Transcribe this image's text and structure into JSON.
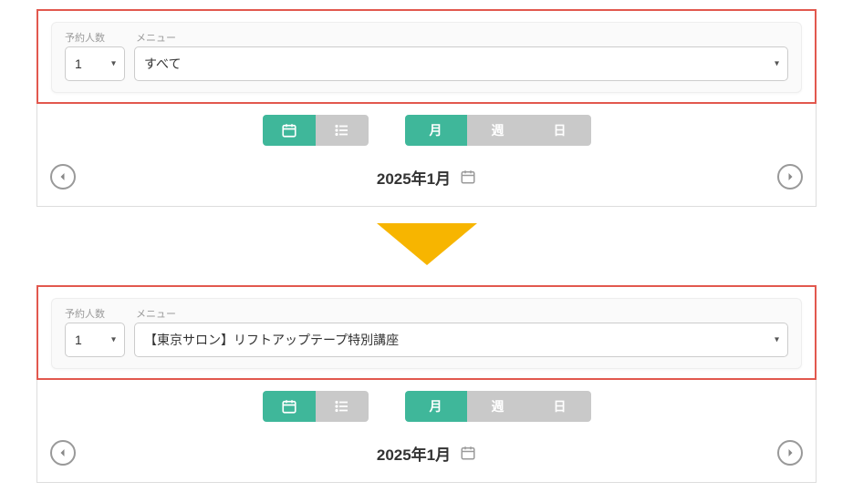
{
  "labels": {
    "qty": "予約人数",
    "menu": "メニュー"
  },
  "before": {
    "qty": "1",
    "menu": "すべて",
    "date": "2025年1月"
  },
  "after": {
    "qty": "1",
    "menu": "【東京サロン】リフトアップテープ特別講座",
    "date": "2025年1月"
  },
  "view": {
    "month": "月",
    "week": "週",
    "day": "日"
  }
}
